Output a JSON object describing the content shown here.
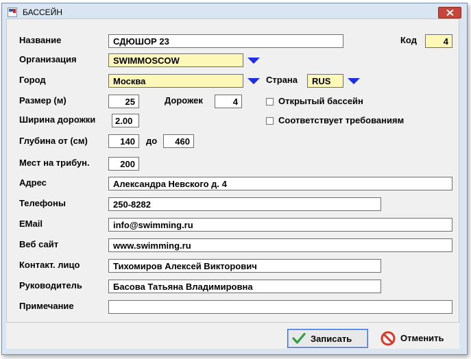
{
  "window": {
    "title": "БАССЕЙН"
  },
  "labels": {
    "name": "Название",
    "code": "Код",
    "organization": "Организация",
    "city": "Город",
    "country": "Страна",
    "size": "Размер (м)",
    "lanes": "Дорожек",
    "lane_width": "Ширина дорожки",
    "depth_from": "Глубина от (см)",
    "depth_to": "до",
    "seats": "Мест на трибун.",
    "address": "Адрес",
    "phones": "Телефоны",
    "email": "EMail",
    "website": "Веб сайт",
    "contact": "Контакт. лицо",
    "manager": "Руководитель",
    "note": "Примечание",
    "open_pool": "Открытый бассейн",
    "meets_requirements": "Соответствует требованиям"
  },
  "values": {
    "name": "СДЮШОР 23",
    "code": "4",
    "organization": "SWIMMOSCOW",
    "city": "Москва",
    "country": "RUS",
    "size": "25",
    "lanes": "4",
    "lane_width": "2.00",
    "depth_from": "140",
    "depth_to": "460",
    "seats": "200",
    "address": "Александра Невского д. 4",
    "phones": "250-8282",
    "email": "info@swimming.ru",
    "website": "www.swimming.ru",
    "contact": "Тихомиров Алексей Викторович",
    "manager": "Басова Татьяна Владимировна",
    "note": ""
  },
  "checkboxes": {
    "open_pool": false,
    "meets_requirements": false
  },
  "buttons": {
    "save": "Записать",
    "cancel": "Отменить"
  },
  "colors": {
    "lookup_field": "#fdf8b8",
    "dropdown_arrow": "#1f2ee0",
    "save_check": "#2e9e45",
    "cancel_icon": "#d43a26"
  },
  "icons": {
    "save": "checkmark-icon",
    "cancel": "no-entry-icon",
    "close": "close-icon"
  }
}
